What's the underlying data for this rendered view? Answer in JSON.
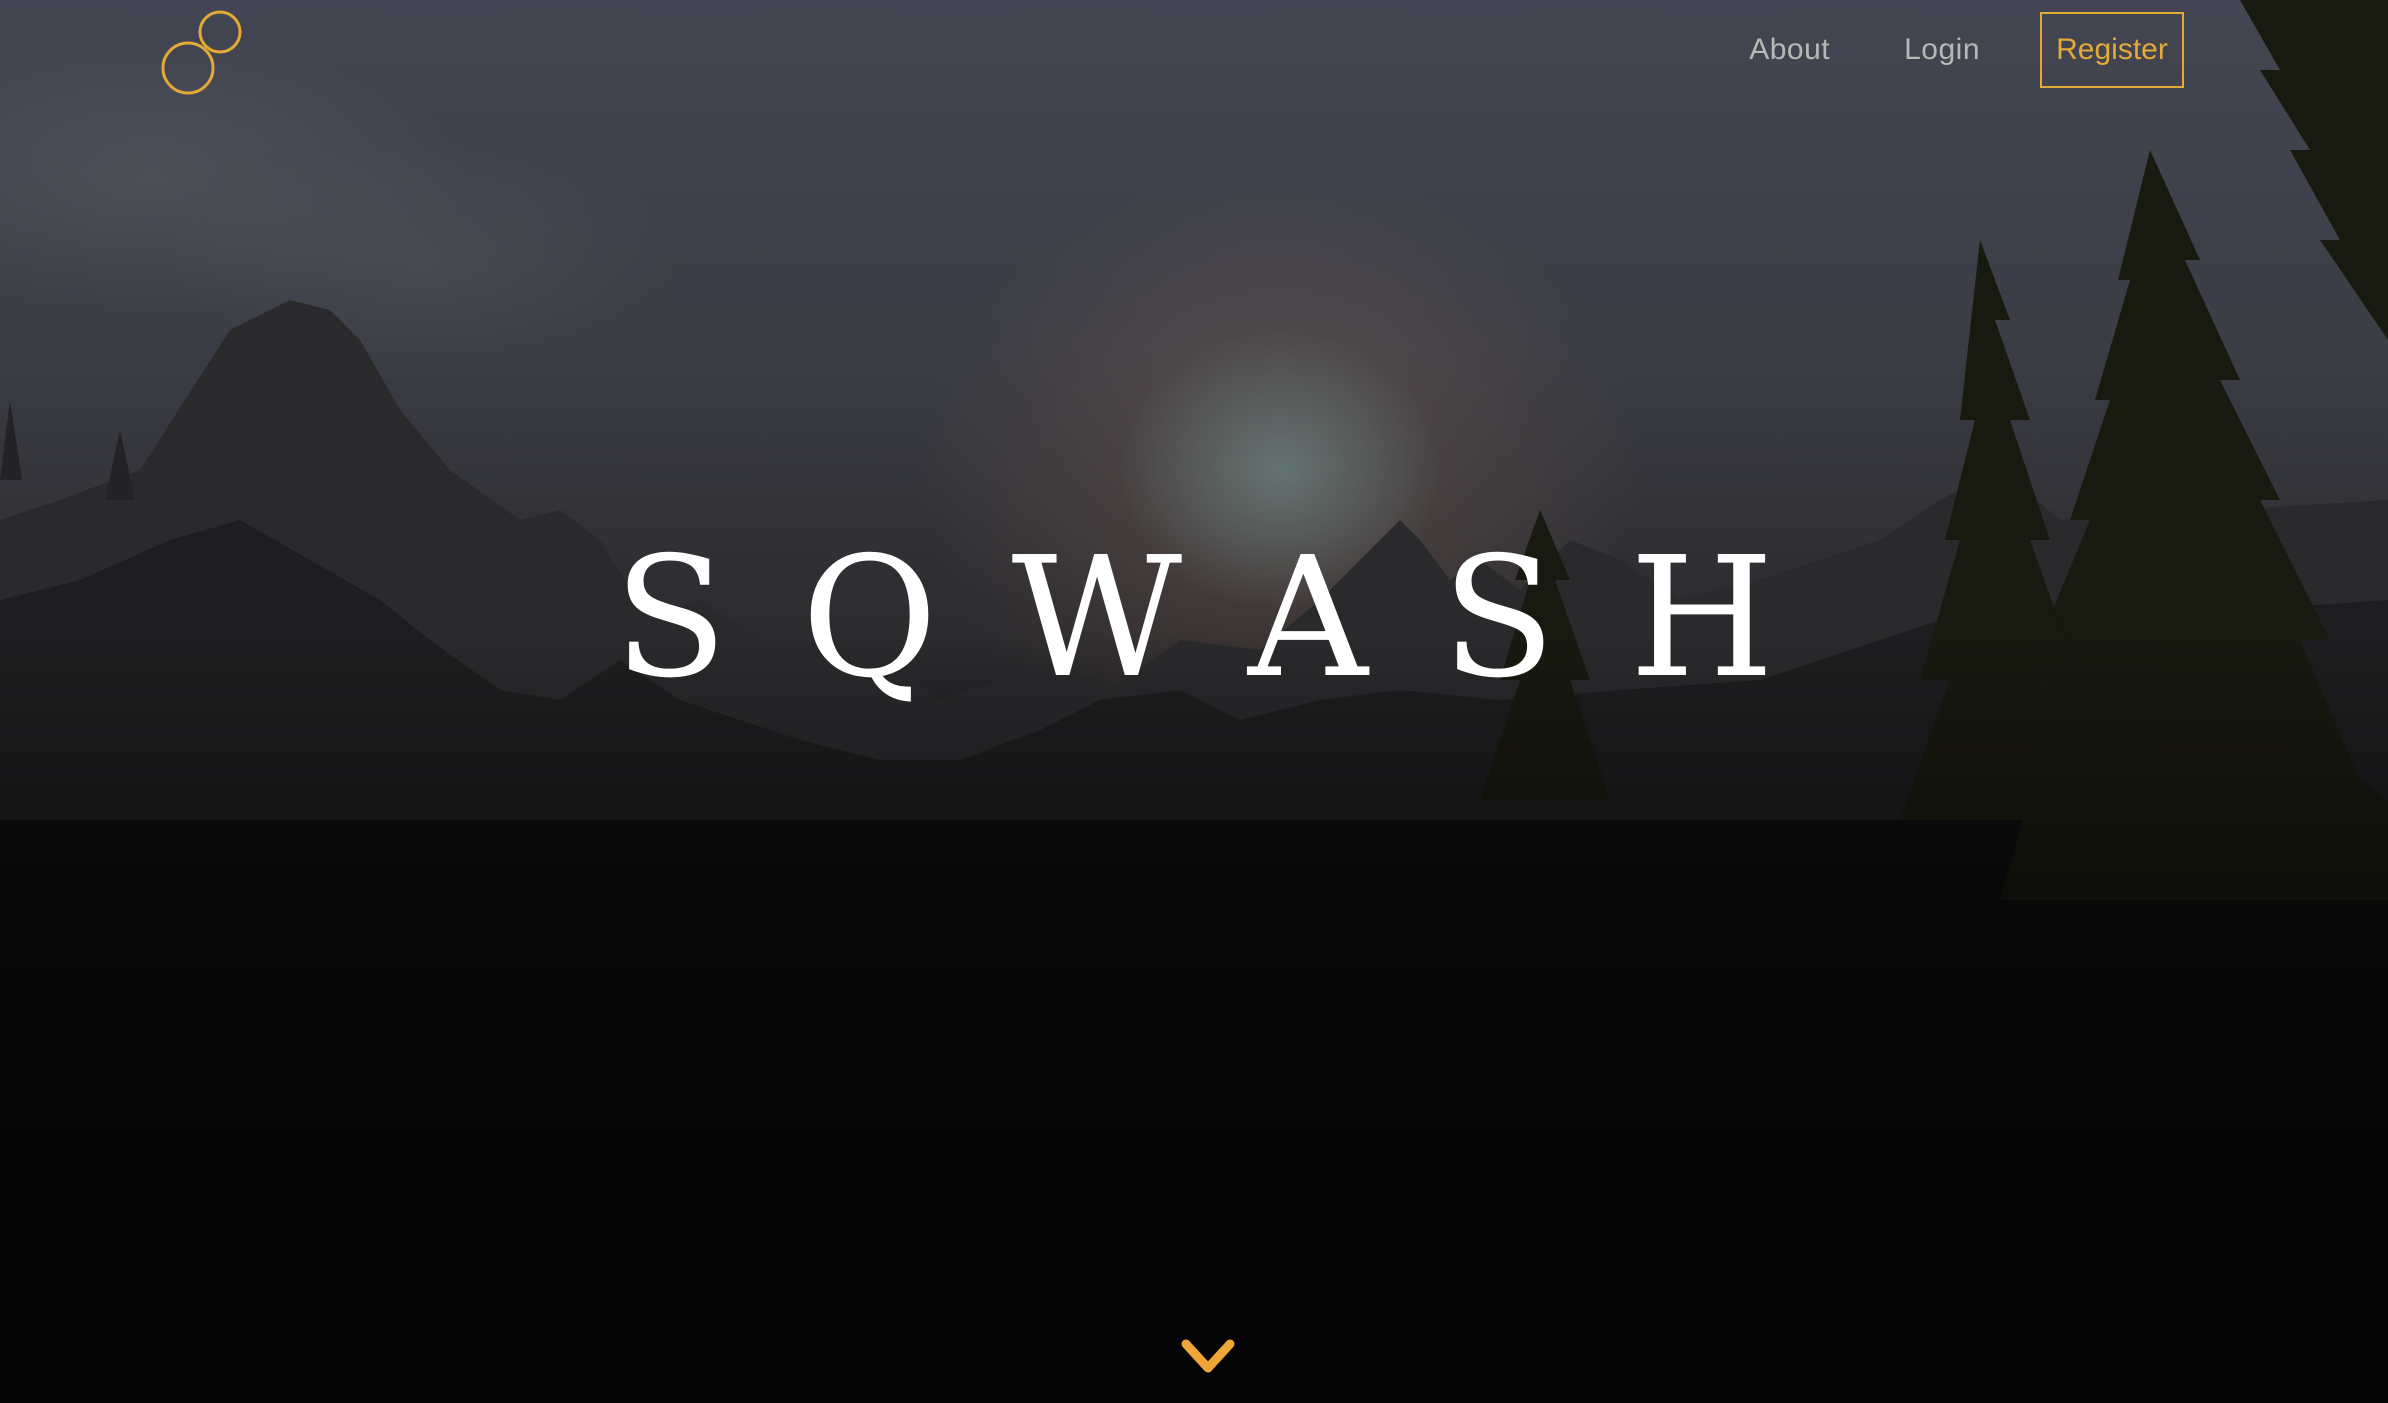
{
  "brand": {
    "logo_icon": "linked-rings-logo-icon",
    "accent_color": "#e3aa37"
  },
  "nav": {
    "about_label": "About",
    "login_label": "Login",
    "register_label": "Register"
  },
  "hero": {
    "title": "SQWASH",
    "background": "dark mountain forest landscape with hazy sun",
    "scroll_icon": "chevron-down-icon"
  }
}
